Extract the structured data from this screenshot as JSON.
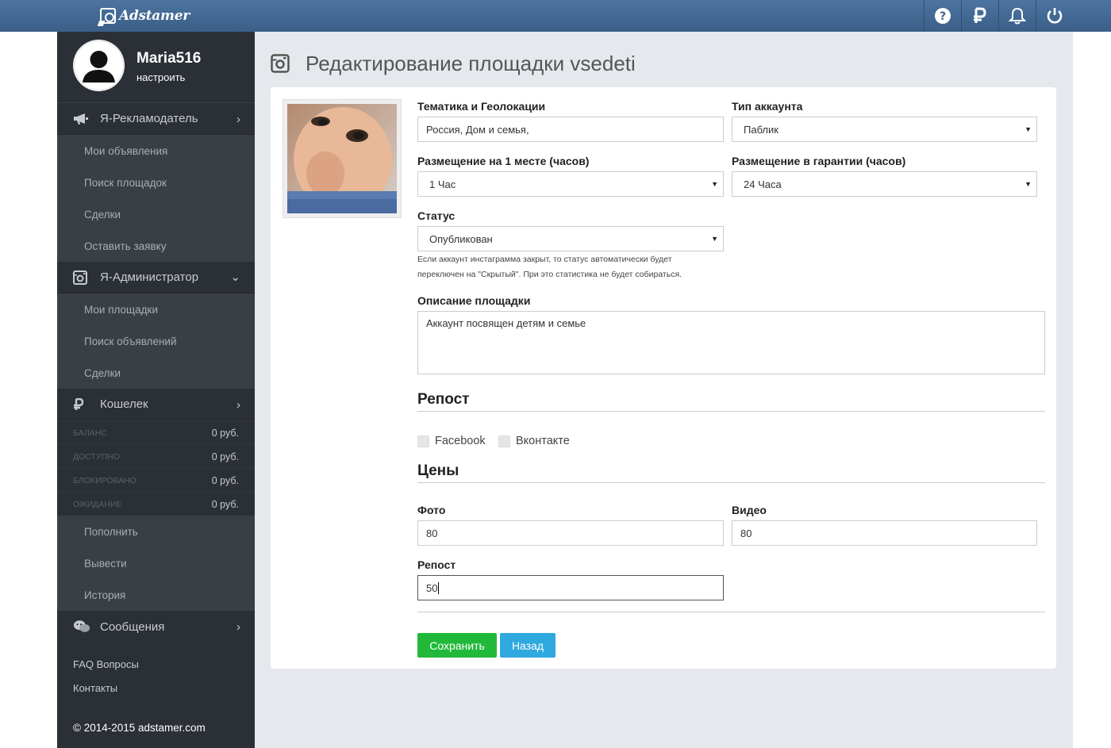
{
  "brand": {
    "name": "Adstamer"
  },
  "topbar": {
    "icons": [
      "help-icon",
      "ruble-icon",
      "bell-icon",
      "power-icon"
    ]
  },
  "sidebar": {
    "user": {
      "name": "Maria516",
      "settings_link": "настроить"
    },
    "advertiser": {
      "label": "Я-Рекламодатель",
      "items": [
        "Мои объявления",
        "Поиск площадок",
        "Сделки",
        "Оставить заявку"
      ]
    },
    "admin": {
      "label": "Я-Администратор",
      "items": [
        "Мои площадки",
        "Поиск объявлений",
        "Сделки"
      ]
    },
    "wallet": {
      "label": "Кошелек",
      "rows": [
        {
          "label": "Баланс",
          "value": "0 руб."
        },
        {
          "label": "Доступно",
          "value": "0 руб."
        },
        {
          "label": "Блокировано",
          "value": "0 руб."
        },
        {
          "label": "Ожидание",
          "value": "0 руб."
        }
      ],
      "items": [
        "Пополнить",
        "Вывести",
        "История"
      ]
    },
    "messages": {
      "label": "Сообщения"
    },
    "footer_links": [
      "FAQ Вопросы",
      "Контакты"
    ],
    "copyright": "© 2014-2015 adstamer.com"
  },
  "main": {
    "title": "Редактирование площадки vsedeti",
    "form": {
      "topic_label": "Тематика и Геолокации",
      "topic_value": "Россия, Дом и семья,",
      "account_type_label": "Тип аккаунта",
      "account_type_value": "Паблик",
      "first_place_label": "Размещение на 1 месте (часов)",
      "first_place_value": "1 Час",
      "guarantee_label": "Размещение в гарантии (часов)",
      "guarantee_value": "24 Часа",
      "status_label": "Статус",
      "status_value": "Опубликован",
      "status_note": "Если аккаунт инстаграмма закрыт, то статус автоматически будет переключен на \"Скрытый\". При это статистика не будет собираться.",
      "description_label": "Описание площадки",
      "description_value": "Аккаунт посвящен детям и семье",
      "repost_heading": "Репост",
      "repost_options": [
        "Facebook",
        "Вконтакте"
      ],
      "prices_heading": "Цены",
      "photo_label": "Фото",
      "photo_value": "80",
      "video_label": "Видео",
      "video_value": "80",
      "repost_price_label": "Репост",
      "repost_price_value": "50",
      "save_label": "Сохранить",
      "back_label": "Назад"
    }
  }
}
